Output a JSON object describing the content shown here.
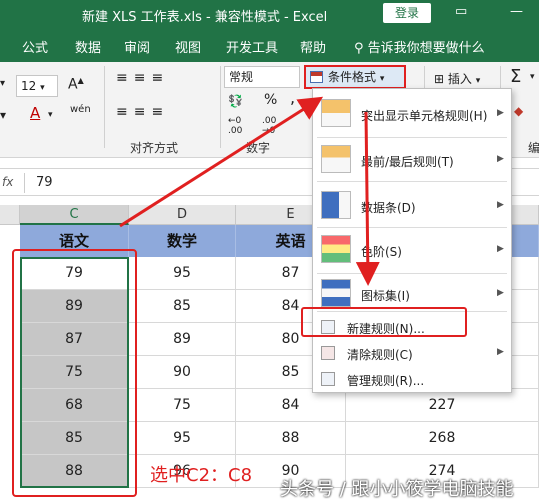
{
  "titlebar": {
    "title": "新建 XLS 工作表.xls  -  兼容性模式  -  Excel",
    "login": "登录",
    "restore_icon": "restore-icon",
    "minimize_icon": "minimize-icon"
  },
  "tabs": [
    "公式",
    "数据",
    "审阅",
    "视图",
    "开发工具",
    "帮助"
  ],
  "tell_me": "告诉我你想要做什么",
  "ribbon": {
    "font_size": "12",
    "number_format": "常规",
    "percent": "%",
    "comma": ",",
    "conditional_format": "条件格式",
    "insert": "插入",
    "sum": "Σ",
    "group_align": "对齐方式",
    "group_number": "数字",
    "group_edit": "编"
  },
  "formula_bar": {
    "fx": "fx",
    "value": "79"
  },
  "columns": [
    "C",
    "D",
    "E"
  ],
  "headers": [
    "语文",
    "数学",
    "英语"
  ],
  "rows": [
    [
      "79",
      "95",
      "87",
      ""
    ],
    [
      "89",
      "85",
      "84",
      ""
    ],
    [
      "87",
      "89",
      "80",
      ""
    ],
    [
      "75",
      "90",
      "85",
      ""
    ],
    [
      "68",
      "75",
      "84",
      "227"
    ],
    [
      "85",
      "95",
      "88",
      "268"
    ],
    [
      "88",
      "96",
      "90",
      "274"
    ]
  ],
  "menu": {
    "items": [
      {
        "label": "突出显示单元格规则(H)",
        "arrow": "▶"
      },
      {
        "label": "最前/最后规则(T)",
        "arrow": "▶"
      },
      {
        "label": "数据条(D)",
        "arrow": "▶"
      },
      {
        "label": "色阶(S)",
        "arrow": "▶"
      },
      {
        "label": "图标集(I)",
        "arrow": "▶"
      },
      {
        "label": "新建规则(N)...",
        "arrow": ""
      },
      {
        "label": "清除规则(C)",
        "arrow": "▶"
      },
      {
        "label": "管理规则(R)...",
        "arrow": ""
      }
    ]
  },
  "annotation": "选中C2：C8",
  "watermark": "头条号 / 跟小小筱学电脑技能"
}
